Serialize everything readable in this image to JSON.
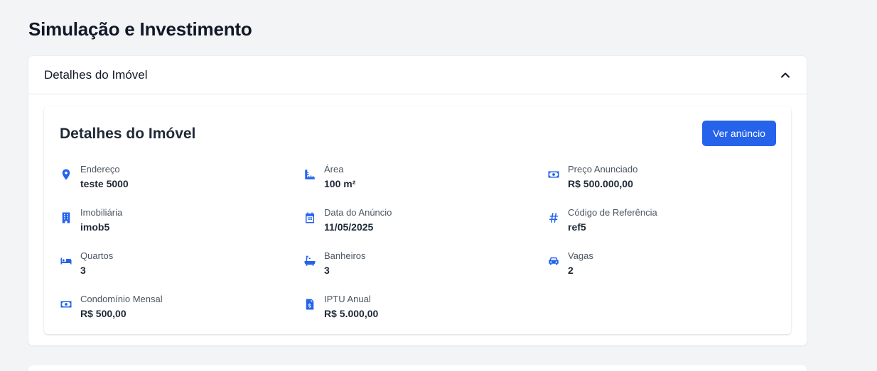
{
  "page": {
    "title": "Simulação e Investimento"
  },
  "accordion": {
    "title": "Detalhes do Imóvel",
    "expanded": true
  },
  "card": {
    "title": "Detalhes do Imóvel",
    "ad_button_label": "Ver anúncio"
  },
  "details": [
    {
      "icon": "map-pin-icon",
      "label": "Endereço",
      "value": "teste 5000"
    },
    {
      "icon": "ruler-icon",
      "label": "Área",
      "value": "100 m²"
    },
    {
      "icon": "money-icon",
      "label": "Preço Anunciado",
      "value": "R$ 500.000,00"
    },
    {
      "icon": "building-icon",
      "label": "Imobiliária",
      "value": "imob5"
    },
    {
      "icon": "calendar-icon",
      "label": "Data do Anúncio",
      "value": "11/05/2025"
    },
    {
      "icon": "hashtag-icon",
      "label": "Código de Referência",
      "value": "ref5"
    },
    {
      "icon": "bed-icon",
      "label": "Quartos",
      "value": "3"
    },
    {
      "icon": "bath-icon",
      "label": "Banheiros",
      "value": "3"
    },
    {
      "icon": "car-icon",
      "label": "Vagas",
      "value": "2"
    },
    {
      "icon": "money-icon",
      "label": "Condomínio Mensal",
      "value": "R$ 500,00"
    },
    {
      "icon": "invoice-icon",
      "label": "IPTU Anual",
      "value": "R$ 5.000,00"
    }
  ],
  "colors": {
    "accent": "#2563eb",
    "background": "#f3f4f6",
    "card": "#ffffff",
    "text": "#111827"
  }
}
